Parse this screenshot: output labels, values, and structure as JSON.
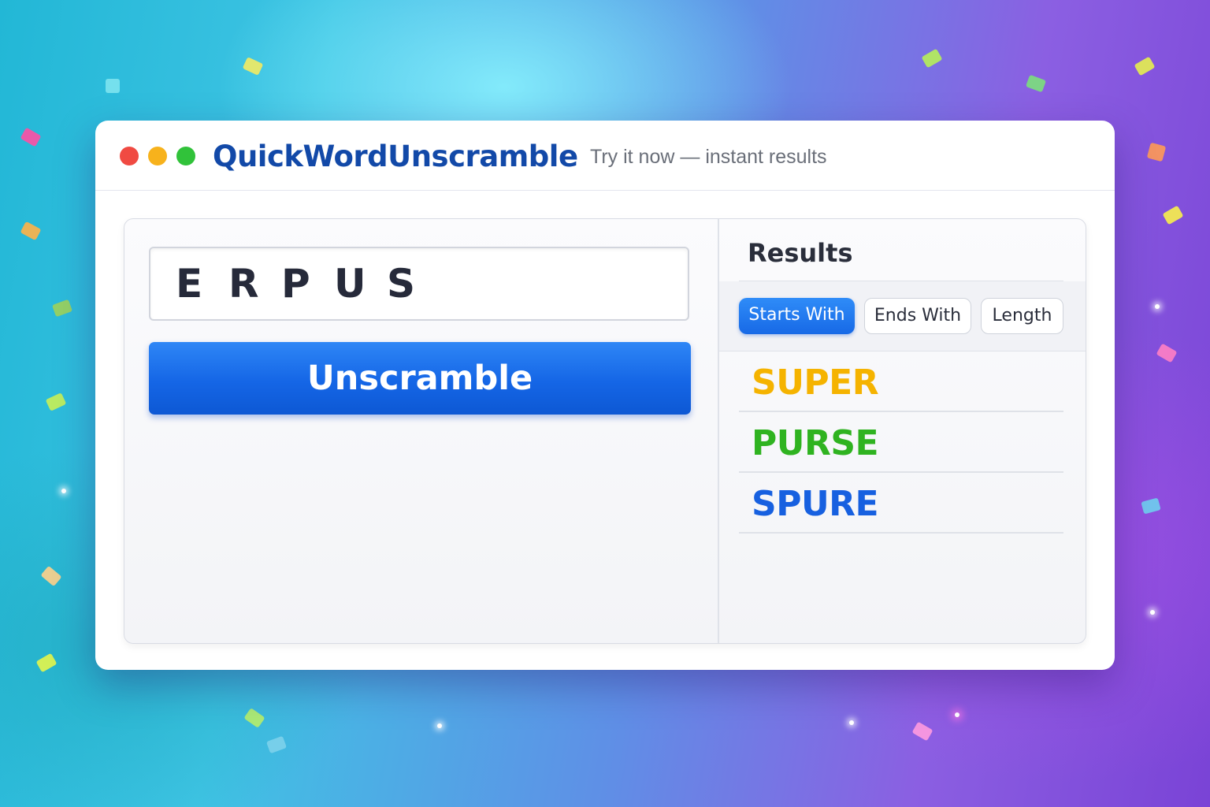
{
  "window": {
    "app_title": "QuickWordUnscramble",
    "tagline": "Try it now — instant results"
  },
  "input": {
    "letters": [
      "E",
      "R",
      "P",
      "U",
      "S"
    ]
  },
  "actions": {
    "unscramble_label": "Unscramble"
  },
  "results": {
    "title": "Results",
    "filters": [
      {
        "label": "Starts With",
        "active": true
      },
      {
        "label": "Ends With",
        "active": false
      },
      {
        "label": "Length",
        "active": false
      }
    ],
    "words": [
      {
        "word": "SUPER",
        "color": "#f5b300"
      },
      {
        "word": "PURSE",
        "color": "#2fb320"
      },
      {
        "word": "SPURE",
        "color": "#1760e0"
      }
    ]
  },
  "colors": {
    "accent": "#1a6ae8",
    "title": "#1249a8"
  }
}
